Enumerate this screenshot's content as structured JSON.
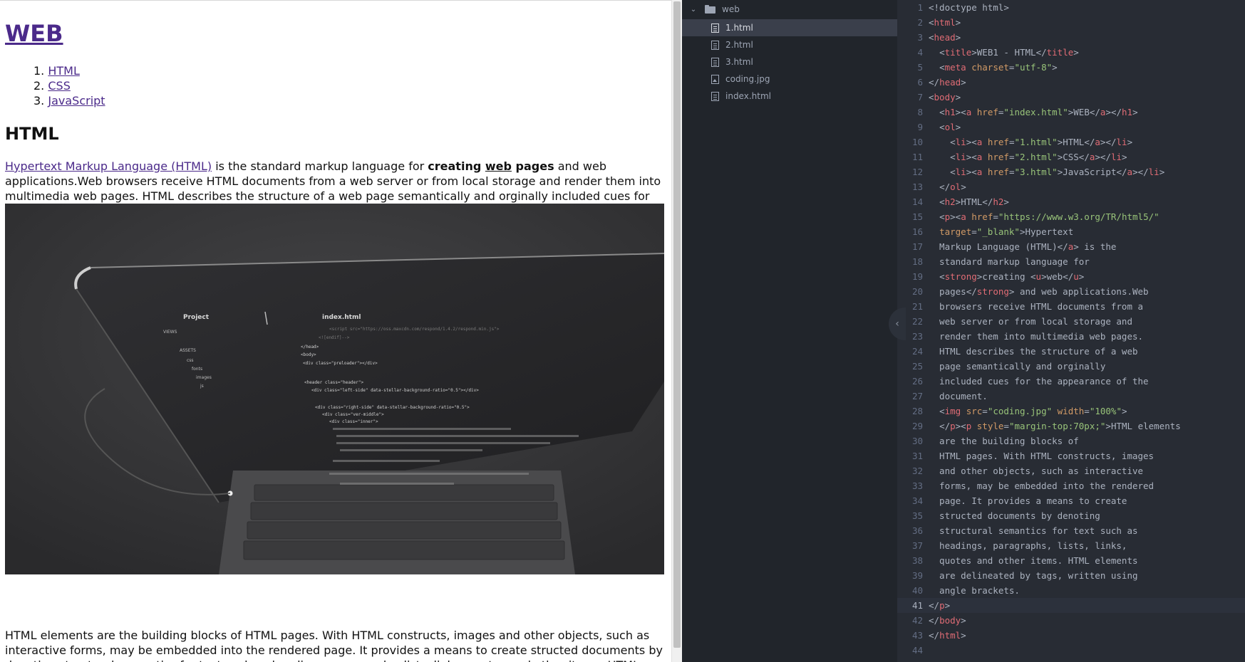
{
  "browser": {
    "h1_link": "WEB",
    "nav": [
      {
        "num": "1.",
        "label": "HTML"
      },
      {
        "num": "2.",
        "label": "CSS"
      },
      {
        "num": "3.",
        "label": "JavaScript"
      }
    ],
    "h2": "HTML",
    "p1_link": "Hypertext Markup Language (HTML)",
    "p1_text_a": " is the standard markup language for ",
    "p1_strong_a": "creating ",
    "p1_u": "web",
    "p1_strong_b": " pages",
    "p1_text_b": " and web applications.Web browsers receive HTML documents from a web server or from local storage and render them into multimedia web pages. HTML describes the structure of a web page semantically and orginally included cues for the appearance of the document.",
    "p2_text": "HTML elements are the building blocks of HTML pages. With HTML constructs, images and other objects, such as interactive forms, may be embedded into the rendered page. It provides a means to create structed documents by denoting structural semantics for text such as headings, paragraphs, lists, links, quotes and other items. HTML elements are delineated by tags, written using angle brackets."
  },
  "photo": {
    "sidebar_title": "Project",
    "tab_title": "index.html",
    "tree_items": [
      "VIEWS",
      "ASSETS",
      "css",
      "fonts",
      "images",
      "js"
    ],
    "code_lines": [
      "<script src=\"https://oss.maxcdn.com/respond/1.4.2/respond.min.js\">",
      "<![endif]-->",
      "</head>",
      "<body>",
      "<div class=\"preloader\"></div>",
      "<header class=\"header\">",
      "<div class=\"left-side\" data-stellar-background-ratio=\"0.5\"></div>",
      "<div class=\"right-side\" data-stellar-background-ratio=\"0.5\">",
      "<div class=\"ver-middle\">",
      "<div class=\"inner\">"
    ]
  },
  "tree": {
    "folder": "web",
    "files": [
      {
        "name": "1.html",
        "icon": "file-text-icon",
        "selected": true
      },
      {
        "name": "2.html",
        "icon": "file-text-icon",
        "selected": false
      },
      {
        "name": "3.html",
        "icon": "file-text-icon",
        "selected": false
      },
      {
        "name": "coding.jpg",
        "icon": "file-image-icon",
        "selected": false
      },
      {
        "name": "index.html",
        "icon": "file-text-icon",
        "selected": false
      }
    ]
  },
  "editor": {
    "active_line": 41,
    "lines": [
      [
        [
          "pun",
          "<!doctype html>"
        ]
      ],
      [
        [
          "pun",
          "<"
        ],
        [
          "tag",
          "html"
        ],
        [
          "pun",
          ">"
        ]
      ],
      [
        [
          "pun",
          "<"
        ],
        [
          "tag",
          "head"
        ],
        [
          "pun",
          ">"
        ]
      ],
      [
        [
          "txt",
          "  "
        ],
        [
          "pun",
          "<"
        ],
        [
          "tag",
          "title"
        ],
        [
          "pun",
          ">"
        ],
        [
          "txt",
          "WEB1 - HTML"
        ],
        [
          "pun",
          "</"
        ],
        [
          "tag",
          "title"
        ],
        [
          "pun",
          ">"
        ]
      ],
      [
        [
          "txt",
          "  "
        ],
        [
          "pun",
          "<"
        ],
        [
          "tag",
          "meta"
        ],
        [
          "txt",
          " "
        ],
        [
          "attr",
          "charset"
        ],
        [
          "pun",
          "="
        ],
        [
          "str",
          "\"utf-8\""
        ],
        [
          "pun",
          ">"
        ]
      ],
      [
        [
          "pun",
          "</"
        ],
        [
          "tag",
          "head"
        ],
        [
          "pun",
          ">"
        ]
      ],
      [
        [
          "pun",
          "<"
        ],
        [
          "tag",
          "body"
        ],
        [
          "pun",
          ">"
        ]
      ],
      [
        [
          "txt",
          "  "
        ],
        [
          "pun",
          "<"
        ],
        [
          "tag",
          "h1"
        ],
        [
          "pun",
          "><"
        ],
        [
          "tag",
          "a"
        ],
        [
          "txt",
          " "
        ],
        [
          "attr",
          "href"
        ],
        [
          "pun",
          "="
        ],
        [
          "str",
          "\"index.html\""
        ],
        [
          "pun",
          ">"
        ],
        [
          "txt",
          "WEB"
        ],
        [
          "pun",
          "</"
        ],
        [
          "tag",
          "a"
        ],
        [
          "pun",
          "></"
        ],
        [
          "tag",
          "h1"
        ],
        [
          "pun",
          ">"
        ]
      ],
      [
        [
          "txt",
          "  "
        ],
        [
          "pun",
          "<"
        ],
        [
          "tag",
          "ol"
        ],
        [
          "pun",
          ">"
        ]
      ],
      [
        [
          "txt",
          "    "
        ],
        [
          "pun",
          "<"
        ],
        [
          "tag",
          "li"
        ],
        [
          "pun",
          "><"
        ],
        [
          "tag",
          "a"
        ],
        [
          "txt",
          " "
        ],
        [
          "attr",
          "href"
        ],
        [
          "pun",
          "="
        ],
        [
          "str",
          "\"1.html\""
        ],
        [
          "pun",
          ">"
        ],
        [
          "txt",
          "HTML"
        ],
        [
          "pun",
          "</"
        ],
        [
          "tag",
          "a"
        ],
        [
          "pun",
          "></"
        ],
        [
          "tag",
          "li"
        ],
        [
          "pun",
          ">"
        ]
      ],
      [
        [
          "txt",
          "    "
        ],
        [
          "pun",
          "<"
        ],
        [
          "tag",
          "li"
        ],
        [
          "pun",
          "><"
        ],
        [
          "tag",
          "a"
        ],
        [
          "txt",
          " "
        ],
        [
          "attr",
          "href"
        ],
        [
          "pun",
          "="
        ],
        [
          "str",
          "\"2.html\""
        ],
        [
          "pun",
          ">"
        ],
        [
          "txt",
          "CSS"
        ],
        [
          "pun",
          "</"
        ],
        [
          "tag",
          "a"
        ],
        [
          "pun",
          "></"
        ],
        [
          "tag",
          "li"
        ],
        [
          "pun",
          ">"
        ]
      ],
      [
        [
          "txt",
          "    "
        ],
        [
          "pun",
          "<"
        ],
        [
          "tag",
          "li"
        ],
        [
          "pun",
          "><"
        ],
        [
          "tag",
          "a"
        ],
        [
          "txt",
          " "
        ],
        [
          "attr",
          "href"
        ],
        [
          "pun",
          "="
        ],
        [
          "str",
          "\"3.html\""
        ],
        [
          "pun",
          ">"
        ],
        [
          "txt",
          "JavaScript"
        ],
        [
          "pun",
          "</"
        ],
        [
          "tag",
          "a"
        ],
        [
          "pun",
          "></"
        ],
        [
          "tag",
          "li"
        ],
        [
          "pun",
          ">"
        ]
      ],
      [
        [
          "txt",
          "  "
        ],
        [
          "pun",
          "</"
        ],
        [
          "tag",
          "ol"
        ],
        [
          "pun",
          ">"
        ]
      ],
      [
        [
          "txt",
          "  "
        ],
        [
          "pun",
          "<"
        ],
        [
          "tag",
          "h2"
        ],
        [
          "pun",
          ">"
        ],
        [
          "txt",
          "HTML"
        ],
        [
          "pun",
          "</"
        ],
        [
          "tag",
          "h2"
        ],
        [
          "pun",
          ">"
        ]
      ],
      [
        [
          "txt",
          "  "
        ],
        [
          "pun",
          "<"
        ],
        [
          "tag",
          "p"
        ],
        [
          "pun",
          "><"
        ],
        [
          "tag",
          "a"
        ],
        [
          "txt",
          " "
        ],
        [
          "attr",
          "href"
        ],
        [
          "pun",
          "="
        ],
        [
          "str",
          "\"https://www.w3.org/TR/html5/\""
        ]
      ],
      [
        [
          "txt",
          "  "
        ],
        [
          "attr",
          "target"
        ],
        [
          "pun",
          "="
        ],
        [
          "str",
          "\"_blank\""
        ],
        [
          "pun",
          ">"
        ],
        [
          "txt",
          "Hypertext"
        ]
      ],
      [
        [
          "txt",
          "  Markup Language (HTML)"
        ],
        [
          "pun",
          "</"
        ],
        [
          "tag",
          "a"
        ],
        [
          "pun",
          ">"
        ],
        [
          "txt",
          " is the"
        ]
      ],
      [
        [
          "txt",
          "  standard markup language for"
        ]
      ],
      [
        [
          "txt",
          "  "
        ],
        [
          "pun",
          "<"
        ],
        [
          "tag",
          "strong"
        ],
        [
          "pun",
          ">"
        ],
        [
          "txt",
          "creating "
        ],
        [
          "pun",
          "<"
        ],
        [
          "tag",
          "u"
        ],
        [
          "pun",
          ">"
        ],
        [
          "txt",
          "web"
        ],
        [
          "pun",
          "</"
        ],
        [
          "tag",
          "u"
        ],
        [
          "pun",
          ">"
        ]
      ],
      [
        [
          "txt",
          "  pages"
        ],
        [
          "pun",
          "</"
        ],
        [
          "tag",
          "strong"
        ],
        [
          "pun",
          ">"
        ],
        [
          "txt",
          " and web applications.Web"
        ]
      ],
      [
        [
          "txt",
          "  browsers receive HTML documents from a"
        ]
      ],
      [
        [
          "txt",
          "  web server or from local storage and"
        ]
      ],
      [
        [
          "txt",
          "  render them into multimedia web pages."
        ]
      ],
      [
        [
          "txt",
          "  HTML describes the structure of a web"
        ]
      ],
      [
        [
          "txt",
          "  page semantically and orginally"
        ]
      ],
      [
        [
          "txt",
          "  included cues for the appearance of the"
        ]
      ],
      [
        [
          "txt",
          "  document."
        ]
      ],
      [
        [
          "txt",
          "  "
        ],
        [
          "pun",
          "<"
        ],
        [
          "tag",
          "img"
        ],
        [
          "txt",
          " "
        ],
        [
          "attr",
          "src"
        ],
        [
          "pun",
          "="
        ],
        [
          "str",
          "\"coding.jpg\""
        ],
        [
          "txt",
          " "
        ],
        [
          "attr",
          "width"
        ],
        [
          "pun",
          "="
        ],
        [
          "str",
          "\"100%\""
        ],
        [
          "pun",
          ">"
        ]
      ],
      [
        [
          "txt",
          "  "
        ],
        [
          "pun",
          "</"
        ],
        [
          "tag",
          "p"
        ],
        [
          "pun",
          "><"
        ],
        [
          "tag",
          "p"
        ],
        [
          "txt",
          " "
        ],
        [
          "attr",
          "style"
        ],
        [
          "pun",
          "="
        ],
        [
          "str",
          "\"margin-top:70px;\""
        ],
        [
          "pun",
          ">"
        ],
        [
          "txt",
          "HTML elements"
        ]
      ],
      [
        [
          "txt",
          "  are the building blocks of"
        ]
      ],
      [
        [
          "txt",
          "  HTML pages. With HTML constructs, images"
        ]
      ],
      [
        [
          "txt",
          "  and other objects, such as interactive"
        ]
      ],
      [
        [
          "txt",
          "  forms, may be embedded into the rendered"
        ]
      ],
      [
        [
          "txt",
          "  page. It provides a means to create"
        ]
      ],
      [
        [
          "txt",
          "  structed documents by denoting"
        ]
      ],
      [
        [
          "txt",
          "  structural semantics for text such as"
        ]
      ],
      [
        [
          "txt",
          "  headings, paragraphs, lists, links,"
        ]
      ],
      [
        [
          "txt",
          "  quotes and other items. HTML elements"
        ]
      ],
      [
        [
          "txt",
          "  are delineated by tags, written using"
        ]
      ],
      [
        [
          "txt",
          "  angle brackets."
        ]
      ],
      [
        [
          "pun",
          "</"
        ],
        [
          "tag",
          "p"
        ],
        [
          "pun",
          ">"
        ]
      ],
      [
        [
          "pun",
          "</"
        ],
        [
          "tag",
          "body"
        ],
        [
          "pun",
          ">"
        ]
      ],
      [
        [
          "pun",
          "</"
        ],
        [
          "tag",
          "html"
        ],
        [
          "pun",
          ">"
        ]
      ],
      []
    ]
  },
  "colors": {
    "link": "#4b2a8a",
    "tree_bg": "#21252b",
    "editor_bg": "#282c34",
    "tag": "#e06c75",
    "attr": "#d19a66",
    "string": "#98c379",
    "line_number": "#636d83"
  }
}
